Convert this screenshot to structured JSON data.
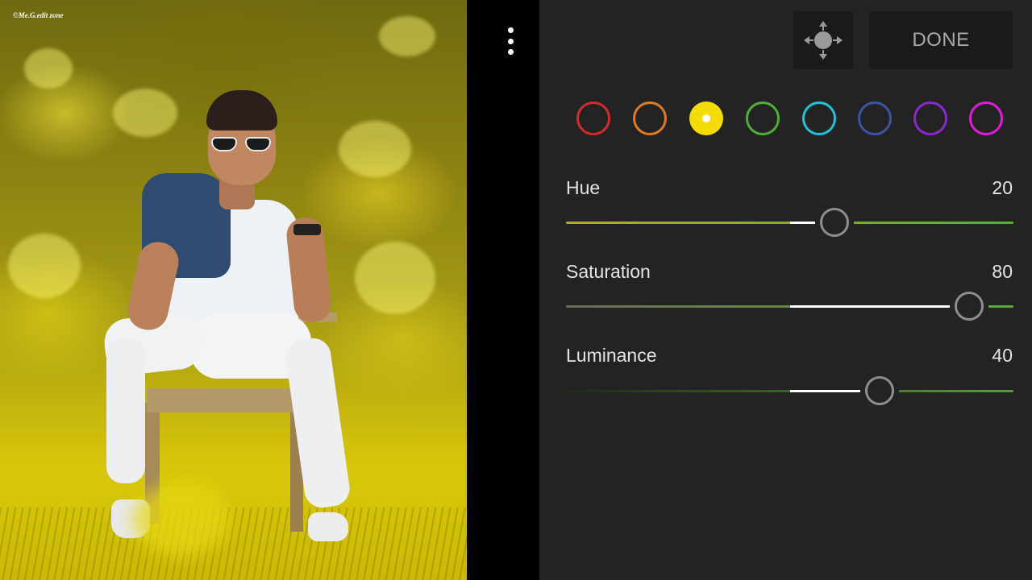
{
  "photo": {
    "watermark": "©Me.G.edit zone"
  },
  "toolbar": {
    "menu_icon": "more-vertical-icon",
    "move_icon": "move-arrows-icon",
    "done_label": "DONE"
  },
  "color_swatches": [
    {
      "name": "red",
      "color": "#d42a2a",
      "selected": false
    },
    {
      "name": "orange",
      "color": "#e07a24",
      "selected": false
    },
    {
      "name": "yellow",
      "color": "#f4dc05",
      "selected": true
    },
    {
      "name": "green",
      "color": "#4fae3b",
      "selected": false
    },
    {
      "name": "aqua",
      "color": "#1ec4d6",
      "selected": false
    },
    {
      "name": "blue",
      "color": "#3a53a5",
      "selected": false
    },
    {
      "name": "purple",
      "color": "#8a27cf",
      "selected": false
    },
    {
      "name": "magenta",
      "color": "#e01ad8",
      "selected": false
    }
  ],
  "sliders": [
    {
      "label": "Hue",
      "value": "20",
      "level": 20,
      "min": -100,
      "max": 100,
      "track_left": "#b5a830",
      "track_right": "#56b22b"
    },
    {
      "label": "Saturation",
      "value": "80",
      "level": 80,
      "min": -100,
      "max": 100,
      "track_left": "#6b6b58",
      "track_right": "#5aa83a"
    },
    {
      "label": "Luminance",
      "value": "40",
      "level": 40,
      "min": -100,
      "max": 100,
      "track_left": "#202a18",
      "track_right": "#5a9a3e"
    }
  ]
}
